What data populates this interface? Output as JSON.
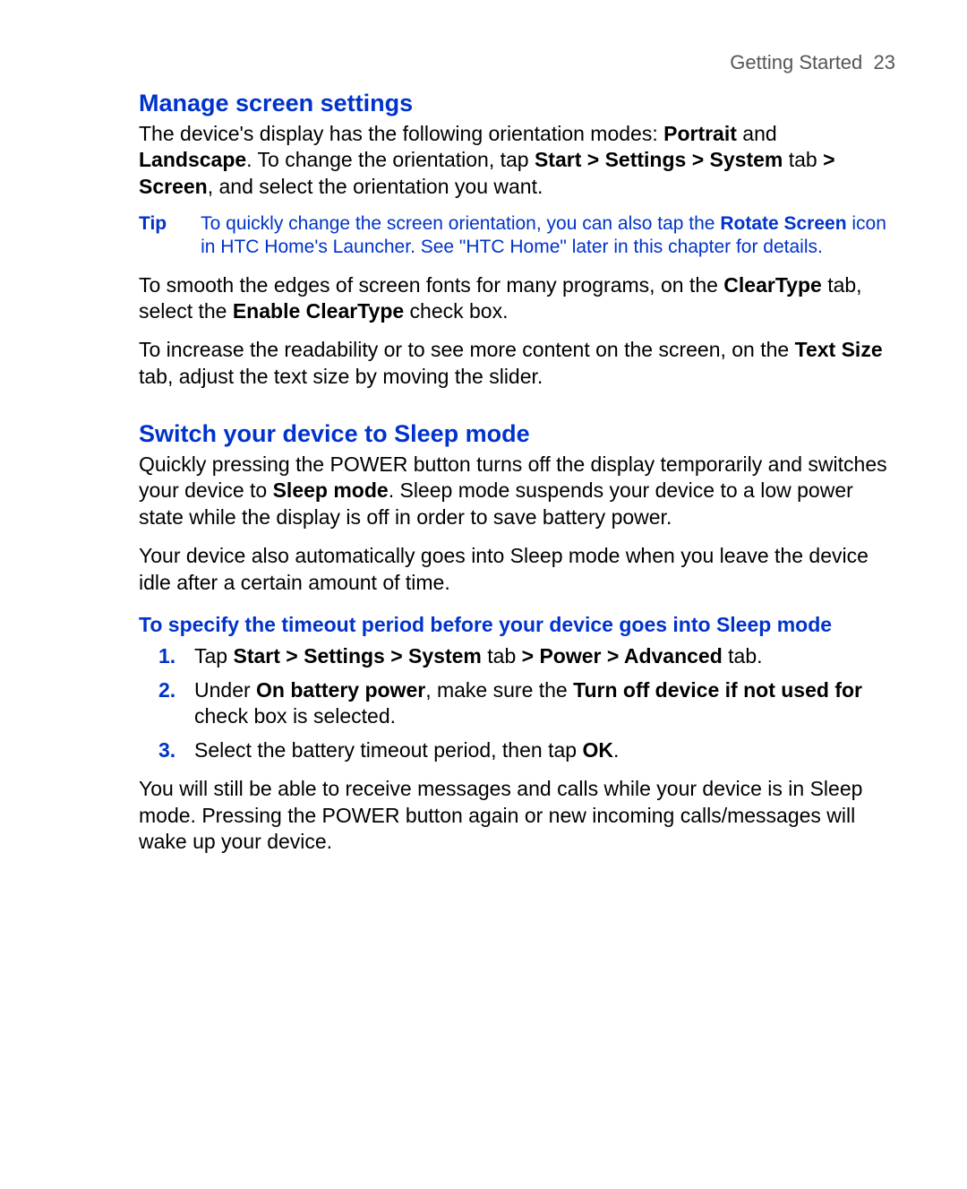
{
  "header": {
    "section": "Getting Started",
    "page": "23"
  },
  "s1": {
    "title": "Manage screen settings",
    "p1_a": "The device's display has the following orientation modes: ",
    "p1_b_portrait": "Portrait",
    "p1_c": " and ",
    "p1_d_landscape": "Landscape",
    "p1_e": ". To change the orientation, tap ",
    "p1_f_path": "Start > Settings > System",
    "p1_g": " tab ",
    "p1_h_gt": "> Screen",
    "p1_i": ", and select the orientation you want.",
    "tip_label": "Tip",
    "tip_a": "To quickly change the screen orientation, you can also tap the ",
    "tip_b_rotate": "Rotate Screen",
    "tip_c": " icon in HTC Home's Launcher. See \"HTC Home\" later in this chapter for details.",
    "p2_a": "To smooth the edges of screen fonts for many programs, on the ",
    "p2_b_cleartype": "ClearType",
    "p2_c": " tab, select the ",
    "p2_d_enable": "Enable ClearType",
    "p2_e": " check box.",
    "p3_a": "To increase the readability or to see more content on the screen, on the ",
    "p3_b_textsize": "Text Size",
    "p3_c": " tab, adjust the text size by moving the slider."
  },
  "s2": {
    "title": "Switch your device to Sleep mode",
    "p1_a": "Quickly pressing the POWER button turns off the display temporarily and switches your device to ",
    "p1_b_sleep": "Sleep mode",
    "p1_c": ". Sleep mode suspends your device to a low power state while the display is off in order to save battery power.",
    "p2": "Your device also automatically goes into Sleep mode when you leave the device idle after a certain amount of time.",
    "sub": "To specify the timeout period before your device goes into Sleep mode",
    "step1_a": "Tap ",
    "step1_b": "Start > Settings > System",
    "step1_c": " tab ",
    "step1_d": "> Power > Advanced",
    "step1_e": " tab.",
    "step2_a": "Under ",
    "step2_b": "On battery power",
    "step2_c": ", make sure the ",
    "step2_d": "Turn off device if not used for",
    "step2_e": " check box is selected.",
    "step3_a": "Select the battery timeout period, then tap ",
    "step3_b": "OK",
    "step3_c": ".",
    "p3": "You will still be able to receive messages and calls while your device is in Sleep mode. Pressing the POWER button again or new incoming calls/messages will wake up your device."
  }
}
